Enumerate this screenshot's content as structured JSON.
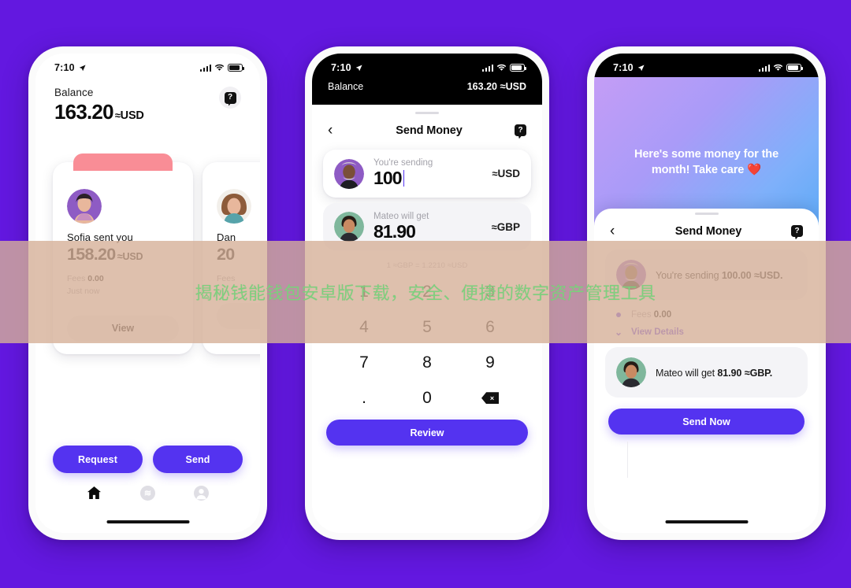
{
  "background_color": "#6318E0",
  "accent_color": "#5433F0",
  "pink_accent": "#F98D96",
  "overlay": {
    "text": "揭秘钱能钱包安卓版下载，安全、便捷的数字资产管理工具",
    "band_color": "rgba(214,176,152,0.80)",
    "text_color": "#7ED07E"
  },
  "status_bar": {
    "time": "7:10",
    "location_icon": "location-arrow-icon",
    "signal_icon": "signal-bars-icon",
    "wifi_icon": "wifi-icon",
    "battery_icon": "battery-icon"
  },
  "phone1": {
    "balance_label": "Balance",
    "balance_amount": "163.20",
    "balance_wave": "≈",
    "balance_currency": "USD",
    "help_icon": "help-question-icon",
    "help_glyph": "?",
    "cards": [
      {
        "name": "Sofia sent you",
        "amount": "158.20",
        "wave": "≈",
        "currency": "USD",
        "fees_label": "Fees",
        "fees_value": "0.00",
        "time": "Just now",
        "view_label": "View"
      },
      {
        "name": "Dan",
        "amount": "20",
        "wave": "≈",
        "currency": "",
        "fees_label": "Fees",
        "fees_value": "",
        "time": "",
        "view_label": ""
      }
    ],
    "request_label": "Request",
    "send_label": "Send",
    "tabs": [
      {
        "icon": "home-icon",
        "glyph": "⌂"
      },
      {
        "icon": "waves-icon",
        "glyph": "≋"
      },
      {
        "icon": "profile-icon",
        "glyph": "●"
      }
    ]
  },
  "phone2": {
    "balance_label": "Balance",
    "balance_amount": "163.20",
    "balance_wave": "≈",
    "balance_currency": "USD",
    "back_icon": "chevron-left-icon",
    "back_glyph": "‹",
    "title": "Send Money",
    "help_icon": "help-question-icon",
    "help_glyph": "?",
    "sending": {
      "label": "You're sending",
      "value": "100",
      "wave": "≈",
      "currency": "USD"
    },
    "receiving": {
      "label": "Mateo will get",
      "value": "81.90",
      "wave": "≈",
      "currency": "GBP"
    },
    "rate": "1 ≈GBP = 1.2210 ≈USD",
    "keys": [
      "1",
      "2",
      "3",
      "4",
      "5",
      "6",
      "7",
      "8",
      "9",
      ".",
      "0",
      "⌫"
    ],
    "delete_icon": "backspace-icon",
    "review_label": "Review"
  },
  "phone3": {
    "message": "Here's some money for the month! Take care ❤️",
    "back_icon": "chevron-left-icon",
    "back_glyph": "‹",
    "title": "Send Money",
    "help_icon": "help-question-icon",
    "help_glyph": "?",
    "sending_text_pre": "You're sending ",
    "sending_amount": "100.00",
    "sending_wave": "≈",
    "sending_currency": "USD.",
    "fees_label": "Fees",
    "fees_value": "0.00",
    "details_icon": "chevron-down-icon",
    "details_glyph": "⌄",
    "details_label": "View Details",
    "receiving_text_pre": "Mateo will get ",
    "receiving_amount": "81.90",
    "receiving_wave": "≈",
    "receiving_currency": "GBP.",
    "send_now_label": "Send Now"
  }
}
